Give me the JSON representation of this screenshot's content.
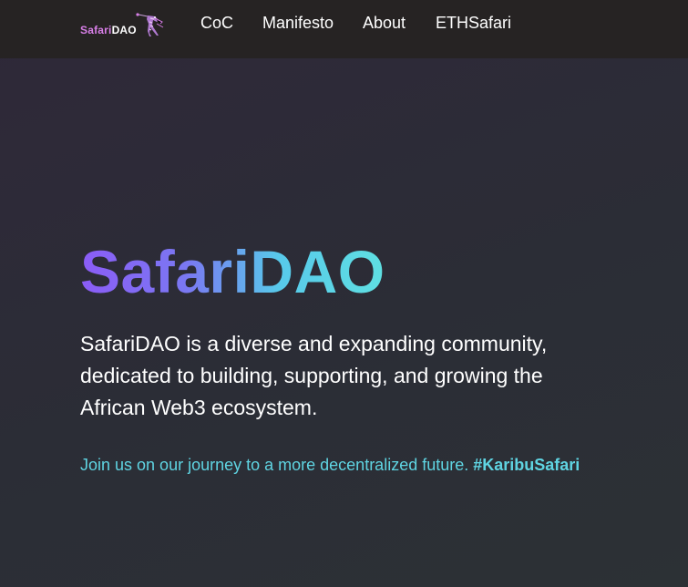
{
  "brand": {
    "name_part1": "Safari",
    "name_part2": "DAO",
    "logo_icon": "safari-giraffe-logo-icon",
    "colors": {
      "part1": "#d77ee6",
      "part2": "#ffffff"
    }
  },
  "nav": {
    "items": [
      {
        "label": "CoC"
      },
      {
        "label": "Manifesto"
      },
      {
        "label": "About"
      },
      {
        "label": "ETHSafari"
      }
    ]
  },
  "hero": {
    "title": "SafariDAO",
    "description": "SafariDAO is a diverse and expanding community, dedicated to building, supporting, and growing the African Web3 ecosystem.",
    "cta_text": "Join us on our journey to a more decentralized future. ",
    "hashtag": "#KaribuSafari"
  },
  "colors": {
    "navbar_bg": "#262323",
    "page_bg": "#2d2b37",
    "title_gradient_start": "#8b5cf6",
    "title_gradient_end": "#5fe0e2",
    "accent_cyan": "#5fd4e2",
    "text": "#ffffff"
  }
}
